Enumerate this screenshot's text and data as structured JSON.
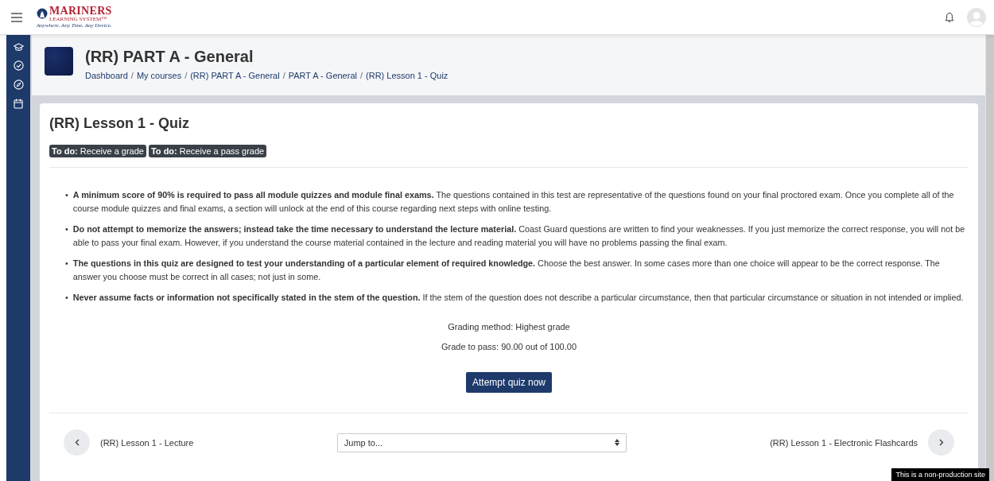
{
  "logo": {
    "name": "MARINERS",
    "subtitle": "LEARNING SYSTEM™",
    "tagline": "Anywhere. Any Time. Any Device."
  },
  "course": {
    "title": "(RR) PART A - General",
    "breadcrumb": [
      {
        "text": "Dashboard"
      },
      {
        "separator": "/",
        "text": "My courses"
      },
      {
        "separator": "/",
        "text": "(RR) PART A - General"
      },
      {
        "separator": "/",
        "text": "PART A - General"
      },
      {
        "separator": "/",
        "text": "(RR) Lesson 1 - Quiz"
      }
    ]
  },
  "quiz": {
    "title": "(RR) Lesson 1 - Quiz",
    "badges": [
      {
        "label": "To do:",
        "text": "Receive a grade"
      },
      {
        "label": "To do:",
        "text": "Receive a pass grade"
      }
    ],
    "instructions": [
      {
        "marker": "•",
        "text": "**A minimum score of 90% is required to pass all module quizzes and module final exams.** The questions contained in this test are representative of the questions found on your final proctored exam. Once you complete all of the course module quizzes and final exams, a section will unlock at the end of this course regarding next steps with online testing."
      },
      {
        "marker": "•",
        "text": "**Do not attempt to memorize the answers; instead take the time necessary to understand the lecture material.** Coast Guard questions are written to find your weaknesses. If you just memorize the correct response, you will not be able to pass your final exam. However, if you understand the course material contained in the lecture and reading material you will have no problems passing the final exam."
      },
      {
        "marker": "•",
        "text": "**The questions in this quiz are designed to test your understanding of a particular element of required knowledge.** Choose the best answer. In some cases more than one choice will appear to be the correct response. The answer you choose must be correct in all cases; not just in some."
      },
      {
        "marker": "•",
        "text": "**Never assume facts or information not specifically stated in the stem of the question.** If the stem of the question does not describe a particular circumstance, then that particular circumstance or situation in not intended or implied."
      }
    ],
    "grading_method": "Grading method: Highest grade",
    "grade_to_pass": "Grade to pass: 90.00 out of 100.00",
    "attempt_button": "Attempt quiz now"
  },
  "footer_nav": {
    "previous": "(RR) Lesson 1 - Lecture",
    "jump": "Jump to...",
    "next": "(RR) Lesson 1 - Electronic Flashcards"
  },
  "notice": "This is a non-production site"
}
